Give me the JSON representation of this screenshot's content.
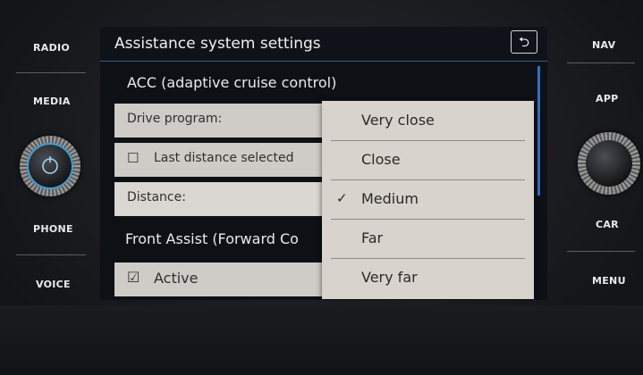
{
  "left_buttons": [
    "RADIO",
    "MEDIA",
    "PHONE",
    "VOICE"
  ],
  "right_buttons": [
    "NAV",
    "APP",
    "CAR",
    "MENU"
  ],
  "header": {
    "title": "Assistance system settings",
    "back_icon": "back-arrow-icon",
    "back_glyph": "⮌"
  },
  "sections": {
    "acc": "ACC (adaptive cruise control)",
    "front_assist": "Front Assist (Forward Co"
  },
  "rows": {
    "drive_program": "Drive program:",
    "last_distance": "Last distance selected",
    "distance": "Distance:",
    "active": "Active"
  },
  "checkboxes": {
    "unchecked": "☐",
    "checked": "☑"
  },
  "dropdown": {
    "options": [
      "Very close",
      "Close",
      "Medium",
      "Far",
      "Very far"
    ],
    "selected": "Medium",
    "check_glyph": "✓"
  },
  "colors": {
    "accent": "#2b72c6",
    "row_bg": "#cfcbc6",
    "dropdown_bg": "#d8d3cc"
  }
}
